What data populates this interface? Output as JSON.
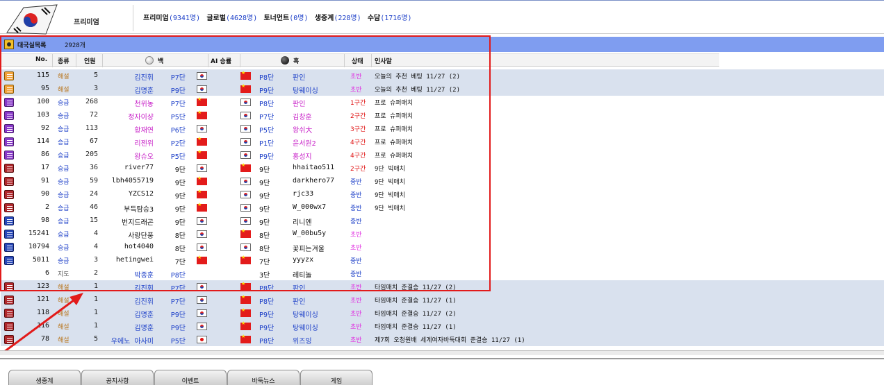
{
  "header": {
    "section_label": "프리미엄",
    "stats": [
      {
        "label": "프리미엄",
        "value": "(9341명)"
      },
      {
        "label": "글로벌",
        "value": "(4628명)"
      },
      {
        "label": "토너먼트",
        "value": "(0명)"
      },
      {
        "label": "생중계",
        "value": "(228명)"
      },
      {
        "label": "수담",
        "value": "(1716명)"
      }
    ]
  },
  "panel": {
    "title": "대국실목록",
    "count": "2928개"
  },
  "columns": {
    "no": "No.",
    "type": "종류",
    "viewers": "인원",
    "white": "백",
    "ai": "AI 승률",
    "black": "흑",
    "status": "상태",
    "greeting": "인사말"
  },
  "rows": [
    {
      "book": "orange",
      "no": "115",
      "type": "해설",
      "type_class": "comment",
      "viewers": "5",
      "wname": "김진휘",
      "wname_class": "c-pro",
      "wrank": "P7단",
      "wflag": "kr",
      "bflag": "cn",
      "brank": "P8단",
      "bname": "판인",
      "bname_class": "c-pro",
      "status": "초반",
      "status_class": "st-early",
      "greeting": "오늘의 추천 베팅 11/27 (2)",
      "hl": true
    },
    {
      "book": "orange",
      "no": "95",
      "type": "해설",
      "type_class": "comment",
      "viewers": "3",
      "wname": "김명훈",
      "wname_class": "c-pro",
      "wrank": "P9단",
      "wflag": "kr",
      "bflag": "cn",
      "brank": "P9단",
      "bname": "탕웨이싱",
      "bname_class": "c-pro",
      "status": "초반",
      "status_class": "st-early",
      "greeting": "오늘의 추천 베팅 11/27 (2)",
      "hl": true
    },
    {
      "book": "purple",
      "no": "100",
      "type": "승급",
      "type_class": "rank",
      "viewers": "268",
      "wname": "천위농",
      "wname_class": "c-pro2",
      "wrank": "P7단",
      "wflag": "cn",
      "bflag": "kr",
      "brank": "P8단",
      "bname": "판인",
      "bname_class": "c-pro2",
      "status": "1구간",
      "status_class": "st-red",
      "greeting": "프로 슈퍼매치",
      "hl": false
    },
    {
      "book": "purple",
      "no": "103",
      "type": "승급",
      "type_class": "rank",
      "viewers": "72",
      "wname": "정자이샹",
      "wname_class": "c-pro2",
      "wrank": "P5단",
      "wflag": "cn",
      "bflag": "kr",
      "brank": "P7단",
      "bname": "김창훈",
      "bname_class": "c-pro2",
      "status": "2구간",
      "status_class": "st-red",
      "greeting": "프로 슈퍼매치",
      "hl": false
    },
    {
      "book": "purple",
      "no": "92",
      "type": "승급",
      "type_class": "rank",
      "viewers": "113",
      "wname": "황재연",
      "wname_class": "c-pro2",
      "wrank": "P6단",
      "wflag": "kr",
      "bflag": "kr",
      "brank": "P5단",
      "bname": "왕쉬大",
      "bname_class": "c-pro2",
      "status": "3구간",
      "status_class": "st-red",
      "greeting": "프로 슈퍼매치",
      "hl": false
    },
    {
      "book": "purple",
      "no": "114",
      "type": "승급",
      "type_class": "rank",
      "viewers": "67",
      "wname": "리젠위",
      "wname_class": "c-pro2",
      "wrank": "P2단",
      "wflag": "cn",
      "bflag": "kr",
      "brank": "P1단",
      "bname": "윤서원2",
      "bname_class": "c-pro2",
      "status": "4구간",
      "status_class": "st-red",
      "greeting": "프로 슈퍼매치",
      "hl": false
    },
    {
      "book": "purple",
      "no": "86",
      "type": "승급",
      "type_class": "rank",
      "viewers": "205",
      "wname": "왕슈오",
      "wname_class": "c-pro2",
      "wrank": "P5단",
      "wflag": "cn",
      "bflag": "kr",
      "brank": "P9단",
      "bname": "홍성지",
      "bname_class": "c-pro2",
      "status": "4구간",
      "status_class": "st-red",
      "greeting": "프로 슈퍼매치",
      "hl": false
    },
    {
      "book": "red",
      "no": "17",
      "type": "승급",
      "type_class": "rank",
      "viewers": "36",
      "wname": "river77",
      "wname_class": "c-normal",
      "wrank": "9단",
      "wflag": "kr",
      "bflag": "cn",
      "brank": "9단",
      "bname": "hhaitao511",
      "bname_class": "c-normal",
      "status": "2구간",
      "status_class": "st-red",
      "greeting": "9단 빅매치",
      "hl": false
    },
    {
      "book": "red",
      "no": "91",
      "type": "승급",
      "type_class": "rank",
      "viewers": "59",
      "wname": "lbh4055719",
      "wname_class": "c-normal",
      "wrank": "9단",
      "wflag": "cn",
      "bflag": "kr",
      "brank": "9단",
      "bname": "darkhero77",
      "bname_class": "c-normal",
      "status": "중반",
      "status_class": "st-mid",
      "greeting": "9단 빅매치",
      "hl": false
    },
    {
      "book": "red",
      "no": "90",
      "type": "승급",
      "type_class": "rank",
      "viewers": "24",
      "wname": "YZCS12",
      "wname_class": "c-normal",
      "wrank": "9단",
      "wflag": "cn",
      "bflag": "kr",
      "brank": "9단",
      "bname": "rjc33",
      "bname_class": "c-normal",
      "status": "중반",
      "status_class": "st-mid",
      "greeting": "9단 빅매치",
      "hl": false
    },
    {
      "book": "red",
      "no": "2",
      "type": "승급",
      "type_class": "rank",
      "viewers": "46",
      "wname": "부득탐승3",
      "wname_class": "c-normal",
      "wrank": "9단",
      "wflag": "cn",
      "bflag": "kr",
      "brank": "9단",
      "bname": "W_000wx7",
      "bname_class": "c-normal",
      "status": "중반",
      "status_class": "st-mid",
      "greeting": "9단 빅매치",
      "hl": false
    },
    {
      "book": "blue",
      "no": "98",
      "type": "승급",
      "type_class": "rank",
      "viewers": "15",
      "wname": "번지드래곤",
      "wname_class": "c-normal",
      "wrank": "9단",
      "wflag": "kr",
      "bflag": "kr",
      "brank": "9단",
      "bname": "리니엔",
      "bname_class": "c-normal",
      "status": "중반",
      "status_class": "st-mid",
      "greeting": "",
      "hl": false
    },
    {
      "book": "blue",
      "no": "15241",
      "type": "승급",
      "type_class": "rank",
      "viewers": "4",
      "wname": "사랑단풍",
      "wname_class": "c-normal",
      "wrank": "8단",
      "wflag": "kr",
      "bflag": "cn",
      "brank": "8단",
      "bname": "W_00bu5y",
      "bname_class": "c-normal",
      "status": "초반",
      "status_class": "st-early",
      "greeting": "",
      "hl": false
    },
    {
      "book": "blue",
      "no": "10794",
      "type": "승급",
      "type_class": "rank",
      "viewers": "4",
      "wname": "hot4040",
      "wname_class": "c-normal",
      "wrank": "8단",
      "wflag": "kr",
      "bflag": "kr",
      "brank": "8단",
      "bname": "꽃피는겨울",
      "bname_class": "c-normal",
      "status": "초반",
      "status_class": "st-early",
      "greeting": "",
      "hl": false
    },
    {
      "book": "blue",
      "no": "5011",
      "type": "승급",
      "type_class": "rank",
      "viewers": "3",
      "wname": "hetingwei",
      "wname_class": "c-normal",
      "wrank": "7단",
      "wflag": "cn",
      "bflag": "cn",
      "brank": "7단",
      "bname": "yyyzx",
      "bname_class": "c-normal",
      "status": "중반",
      "status_class": "st-mid",
      "greeting": "",
      "hl": false
    },
    {
      "book": "none",
      "no": "6",
      "type": "지도",
      "type_class": "teach",
      "viewers": "2",
      "wname": "박종훈",
      "wname_class": "c-pro",
      "wrank": "P8단",
      "wflag": "none",
      "bflag": "none",
      "brank": "3단",
      "bname": "레티놀",
      "bname_class": "c-normal",
      "status": "중반",
      "status_class": "st-mid",
      "greeting": "",
      "hl": false
    },
    {
      "book": "red",
      "no": "123",
      "type": "해설",
      "type_class": "comment",
      "viewers": "1",
      "wname": "김진휘",
      "wname_class": "c-pro",
      "wrank": "P7단",
      "wflag": "kr",
      "bflag": "cn",
      "brank": "P8단",
      "bname": "판인",
      "bname_class": "c-pro",
      "status": "초반",
      "status_class": "st-early",
      "greeting": "타임매치 준결승 11/27 (2)",
      "hl": true
    },
    {
      "book": "red",
      "no": "121",
      "type": "해설",
      "type_class": "comment",
      "viewers": "1",
      "wname": "김진휘",
      "wname_class": "c-pro",
      "wrank": "P7단",
      "wflag": "kr",
      "bflag": "cn",
      "brank": "P8단",
      "bname": "판인",
      "bname_class": "c-pro",
      "status": "초반",
      "status_class": "st-early",
      "greeting": "타임매치 준결승 11/27 (1)",
      "hl": true
    },
    {
      "book": "red",
      "no": "118",
      "type": "해설",
      "type_class": "comment",
      "viewers": "1",
      "wname": "김명훈",
      "wname_class": "c-pro",
      "wrank": "P9단",
      "wflag": "kr",
      "bflag": "cn",
      "brank": "P9단",
      "bname": "탕웨이싱",
      "bname_class": "c-pro",
      "status": "초반",
      "status_class": "st-early",
      "greeting": "타임매치 준결승 11/27 (2)",
      "hl": true
    },
    {
      "book": "red",
      "no": "116",
      "type": "해설",
      "type_class": "comment",
      "viewers": "1",
      "wname": "김명훈",
      "wname_class": "c-pro",
      "wrank": "P9단",
      "wflag": "kr",
      "bflag": "cn",
      "brank": "P9단",
      "bname": "탕웨이싱",
      "bname_class": "c-pro",
      "status": "초반",
      "status_class": "st-early",
      "greeting": "타임매치 준결승 11/27 (1)",
      "hl": true
    },
    {
      "book": "red",
      "no": "78",
      "type": "해설",
      "type_class": "comment",
      "viewers": "5",
      "wname": "우에노 아사미",
      "wname_class": "c-pro",
      "wrank": "P5단",
      "wflag": "jp",
      "bflag": "cn",
      "brank": "P8단",
      "bname": "위즈잉",
      "bname_class": "c-pro",
      "status": "초반",
      "status_class": "st-early",
      "greeting": "제7회 오청원배 세계여자바둑대회 준결승 11/27 (1)",
      "hl": true
    }
  ],
  "tabs": [
    "생중계",
    "공지사항",
    "이벤트",
    "바둑뉴스",
    "게임"
  ],
  "colors": {
    "panel_title_bg": "#7f9df0",
    "highlight_row": "#d9e1ee",
    "annotation": "#e21a1a",
    "pro_name": "#1c3fc8",
    "promo_name": "#c822c8"
  }
}
